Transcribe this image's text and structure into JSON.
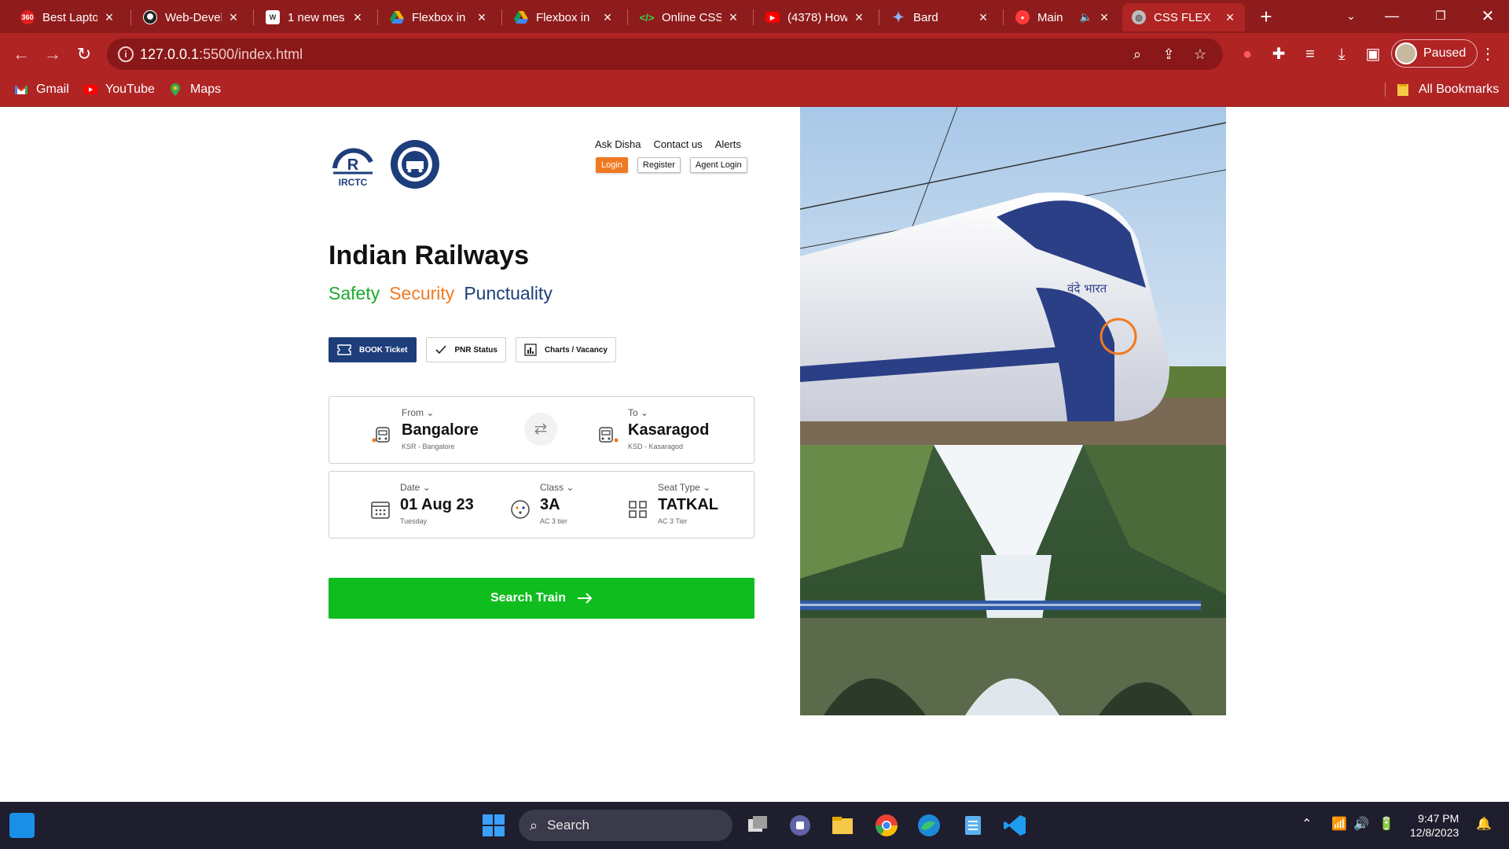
{
  "browser": {
    "tabs": [
      {
        "title": "Best Laptop",
        "favicon": "360-icon",
        "color": "#e02020"
      },
      {
        "title": "Web-Devel",
        "favicon": "github-icon",
        "color": "#ffffff"
      },
      {
        "title": "1 new mes",
        "favicon": "wordpress-icon",
        "color": "#ffffff"
      },
      {
        "title": "Flexbox in",
        "favicon": "drive-icon",
        "color": "#f4b400"
      },
      {
        "title": "Flexbox in",
        "favicon": "drive-icon",
        "color": "#f4b400"
      },
      {
        "title": "Online CSS",
        "favicon": "code-icon",
        "color": "#39d353"
      },
      {
        "title": "(4378) How",
        "favicon": "youtube-icon",
        "color": "#ff0000"
      },
      {
        "title": "Bard",
        "favicon": "sparkle-icon",
        "color": "#8ab4f8"
      },
      {
        "title": "Main",
        "favicon": "record-icon",
        "color": "#ff3b3b"
      },
      {
        "title": "CSS FLEX",
        "favicon": "globe-icon",
        "color": "#bdbdbd"
      }
    ],
    "url_host": "127.0.0.1",
    "url_path": ":5500/index.html",
    "profile_status": "Paused",
    "bookmarks": [
      {
        "label": "Gmail",
        "icon": "gmail-icon"
      },
      {
        "label": "YouTube",
        "icon": "youtube-icon"
      },
      {
        "label": "Maps",
        "icon": "maps-icon"
      }
    ],
    "all_bookmarks": "All Bookmarks"
  },
  "page": {
    "logo_text": "IRCTC",
    "top_links": [
      "Ask Disha",
      "Contact us",
      "Alerts"
    ],
    "auth_buttons": [
      "Login",
      "Register",
      "Agent Login"
    ],
    "headline": "Indian Railways",
    "tagline": [
      {
        "text": "Safety",
        "color": "#1aaa2a"
      },
      {
        "text": "Security",
        "color": "#f07a22"
      },
      {
        "text": "Punctuality",
        "color": "#1e3d7b"
      }
    ],
    "modes": [
      "BOOK Ticket",
      "PNR Status",
      "Charts / Vacancy"
    ],
    "from": {
      "label": "From",
      "value": "Bangalore",
      "sub": "KSR - Bangalore"
    },
    "to": {
      "label": "To",
      "value": "Kasaragod",
      "sub": "KSD - Kasaragod"
    },
    "date": {
      "label": "Date",
      "value": "01 Aug 23",
      "sub": "Tuesday"
    },
    "class": {
      "label": "Class",
      "value": "3A",
      "sub": "AC 3 tier"
    },
    "seat": {
      "label": "Seat Type",
      "value": "TATKAL",
      "sub": "AC 3 Tier"
    },
    "search_button": "Search Train",
    "hero_train_text": "वंदे भारत"
  },
  "taskbar": {
    "search_label": "Search",
    "time": "9:47 PM",
    "date": "12/8/2023"
  }
}
